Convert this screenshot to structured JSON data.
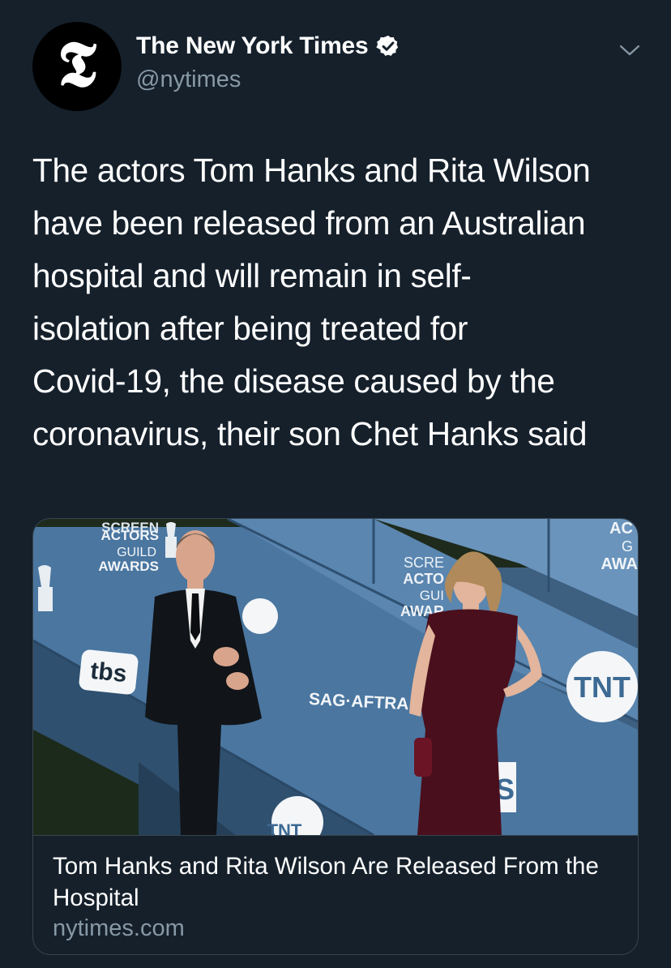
{
  "author": {
    "name": "The New York Times",
    "handle": "@nytimes",
    "avatar_glyph": "𝕿",
    "verified": true
  },
  "tweet": {
    "lines": [
      "The actors Tom Hanks and Rita Wilson",
      "have been released from an Australian",
      "hospital and will remain in self-",
      "isolation after being treated for",
      "Covid-19, the disease caused by the",
      "coronavirus, their son Chet Hanks said"
    ]
  },
  "card": {
    "title": "Tom Hanks and Rita Wilson Are Released From the Hospital",
    "domain": "nytimes.com",
    "image_texts": {
      "sag_top": [
        "SCREEN",
        "ACTORS",
        "GUILD",
        "AWARDS"
      ],
      "sag_mid": [
        "SCRE",
        "ACTO",
        "GUI",
        "AWAR"
      ],
      "sag_right": [
        "AC",
        "G",
        "AWA"
      ],
      "tbs": "tbs",
      "sag_aftra": "SAG·AFTRA",
      "tnt": "TNT",
      "tnt_bottom": "TNT",
      "s_sign": "S"
    }
  },
  "colors": {
    "background": "#15202b",
    "secondary_text": "#8899a6",
    "border": "#38444d",
    "verified_badge": "#ffffff"
  },
  "icons": {
    "verified": "verified-badge-icon",
    "caret": "chevron-down-icon"
  }
}
